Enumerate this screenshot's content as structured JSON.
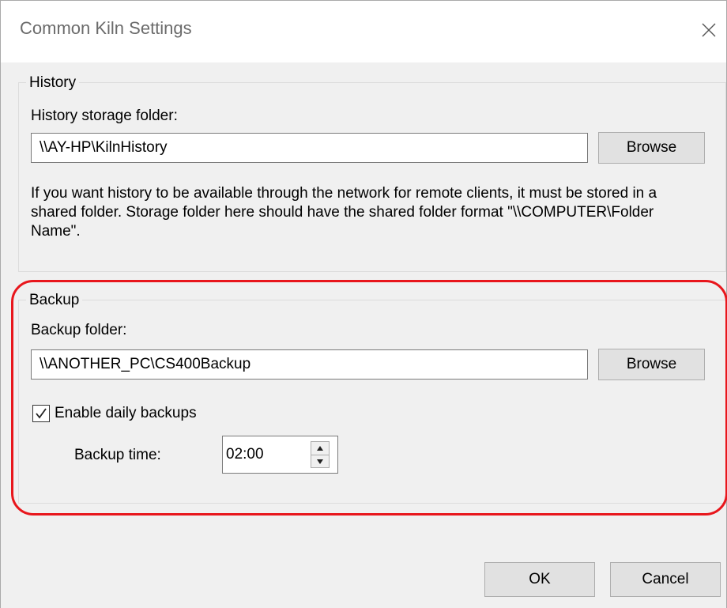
{
  "window": {
    "title": "Common Kiln Settings",
    "close_icon": "close-icon"
  },
  "history": {
    "group_label": "History",
    "folder_label": "History storage folder:",
    "folder_value": "\\\\AY-HP\\KilnHistory",
    "browse_label": "Browse",
    "help_text": "If you want history to be available through the network for remote clients, it must be stored in a shared folder. Storage folder here should have the shared folder format \"\\\\COMPUTER\\Folder Name\"."
  },
  "backup": {
    "group_label": "Backup",
    "folder_label": "Backup folder:",
    "folder_value": "\\\\ANOTHER_PC\\CS400Backup",
    "browse_label": "Browse",
    "enable_label": "Enable daily backups",
    "enable_checked": true,
    "time_label": "Backup time:",
    "time_value": "02:00"
  },
  "footer": {
    "ok_label": "OK",
    "cancel_label": "Cancel"
  },
  "colors": {
    "highlight": "#e8161c",
    "dialog_bg": "#f0f0f0"
  }
}
